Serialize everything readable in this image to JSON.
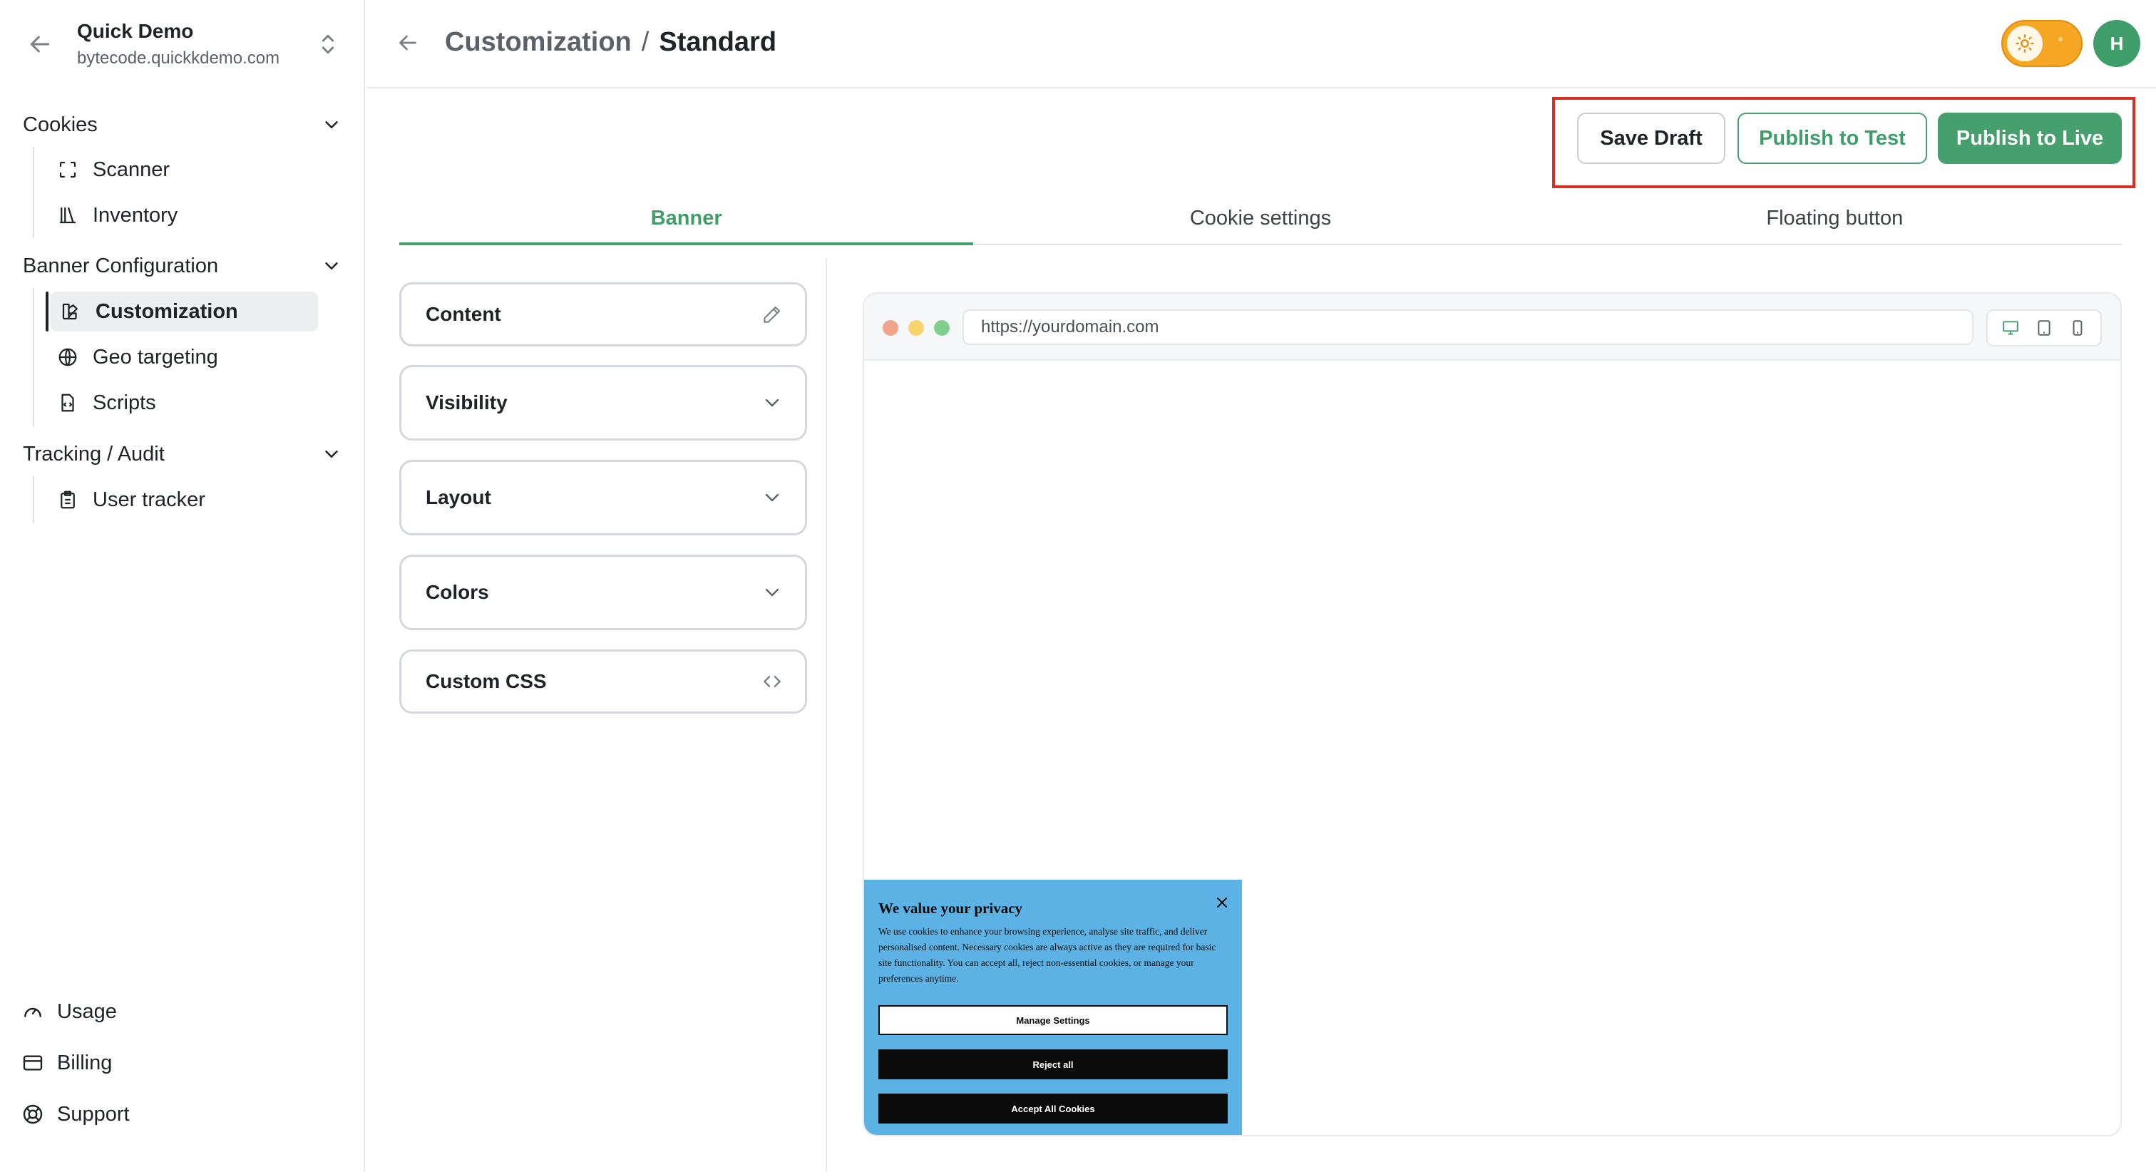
{
  "org": {
    "name": "Quick Demo",
    "domain": "bytecode.quickkdemo.com"
  },
  "sidebar": {
    "sections": [
      {
        "title": "Cookies",
        "items": [
          {
            "label": "Scanner"
          },
          {
            "label": "Inventory"
          }
        ]
      },
      {
        "title": "Banner Configuration",
        "items": [
          {
            "label": "Customization"
          },
          {
            "label": "Geo targeting"
          },
          {
            "label": "Scripts"
          }
        ]
      },
      {
        "title": "Tracking / Audit",
        "items": [
          {
            "label": "User tracker"
          }
        ]
      }
    ],
    "bottom": [
      {
        "label": "Usage"
      },
      {
        "label": "Billing"
      },
      {
        "label": "Support"
      }
    ]
  },
  "header": {
    "breadcrumb_parent": "Customization",
    "breadcrumb_sep": "/",
    "breadcrumb_current": "Standard",
    "avatar_initial": "H",
    "theme_toggle_color": "#f5a623"
  },
  "actions": {
    "save_draft": "Save Draft",
    "publish_test": "Publish to Test",
    "publish_live": "Publish to Live"
  },
  "tabs": [
    {
      "label": "Banner",
      "active": true
    },
    {
      "label": "Cookie settings"
    },
    {
      "label": "Floating button"
    }
  ],
  "panel": {
    "sections": [
      {
        "label": "Content"
      },
      {
        "label": "Visibility"
      },
      {
        "label": "Layout"
      },
      {
        "label": "Colors"
      },
      {
        "label": "Custom CSS"
      }
    ]
  },
  "preview": {
    "url": "https://yourdomain.com",
    "banner": {
      "title": "We value your privacy",
      "text": "We use cookies to enhance your browsing experience, analyse site traffic, and deliver personalised content. Necessary cookies are always active as they are required for basic site functionality. You can accept all, reject non-essential cookies, or manage your preferences anytime.",
      "manage": "Manage Settings",
      "reject": "Reject all",
      "accept": "Accept All Cookies",
      "background": "#5cb2e4"
    }
  },
  "colors": {
    "accent": "#46a06d",
    "highlight": "#d93025"
  }
}
